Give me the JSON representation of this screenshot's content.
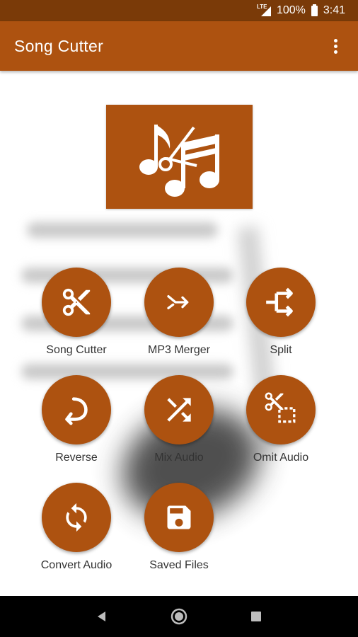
{
  "status_bar": {
    "network": "LTE",
    "battery": "100%",
    "time": "3:41"
  },
  "app_bar": {
    "title": "Song Cutter"
  },
  "colors": {
    "accent": "#ad5210",
    "status_bar": "#7a3a08"
  },
  "tools": [
    {
      "label": "Song Cutter",
      "icon": "scissors-icon"
    },
    {
      "label": "MP3 Merger",
      "icon": "merge-icon"
    },
    {
      "label": "Split",
      "icon": "split-icon"
    },
    {
      "label": "Reverse",
      "icon": "reverse-icon"
    },
    {
      "label": "Mix Audio",
      "icon": "shuffle-icon"
    },
    {
      "label": "Omit Audio",
      "icon": "cut-selection-icon"
    },
    {
      "label": "Convert Audio",
      "icon": "convert-icon"
    },
    {
      "label": "Saved Files",
      "icon": "save-icon"
    }
  ]
}
